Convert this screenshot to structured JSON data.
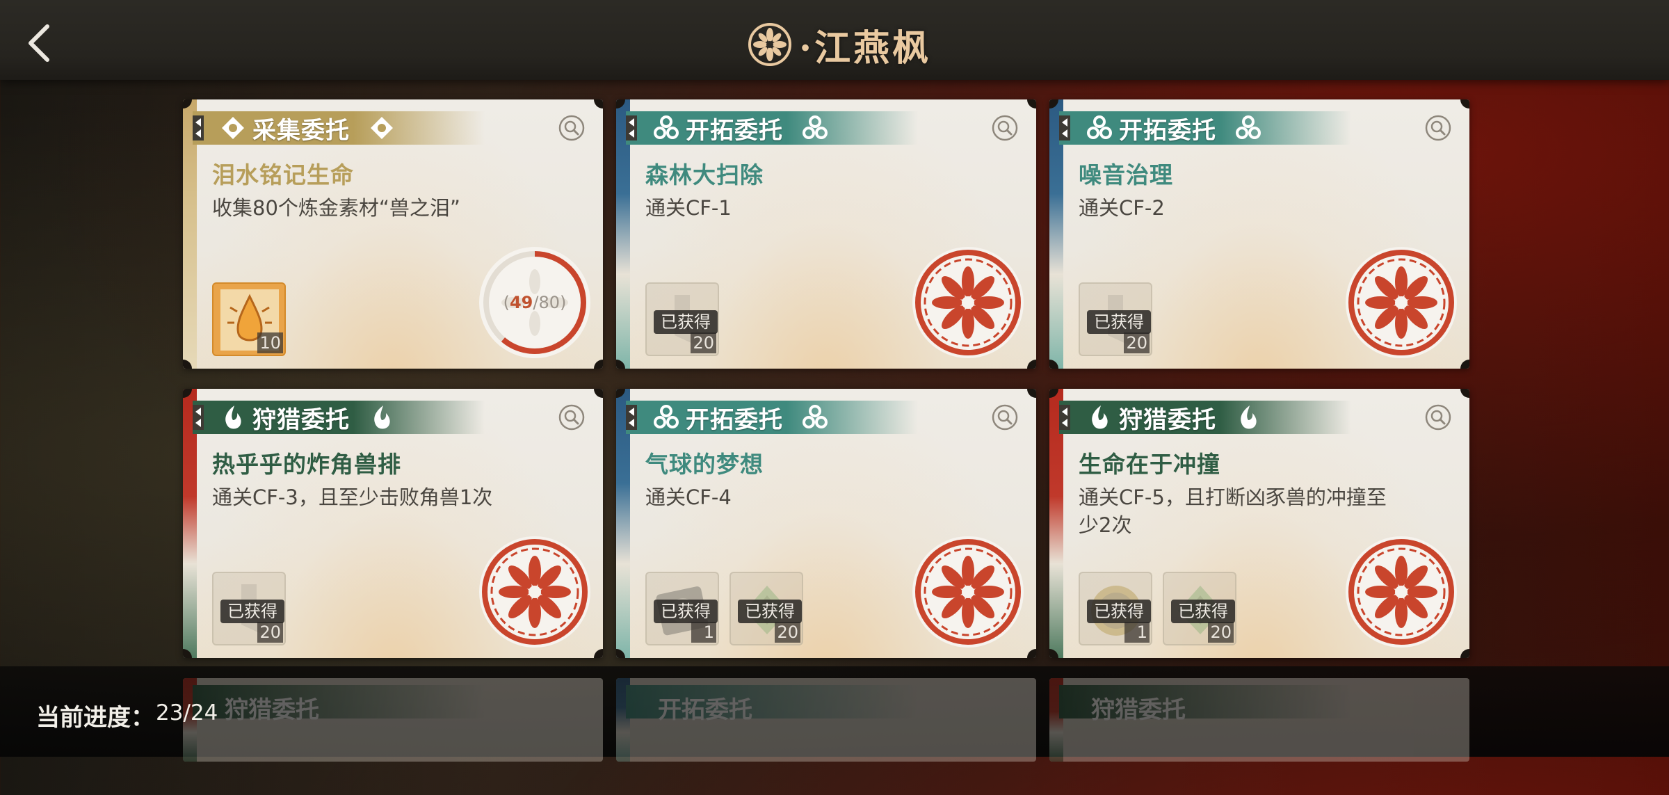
{
  "header": {
    "title": "·江燕枫",
    "back_icon": "chevron-left-icon",
    "emblem_icon": "flower-emblem-icon"
  },
  "colors": {
    "gather": "#b79e5a",
    "explore": "#3f8a7e",
    "hunt": "#2f5d44",
    "hunt_edge": "#b52a1e",
    "explore_edge": "#2c5a82",
    "stamp": "#c9452c"
  },
  "cards": [
    {
      "type": "gather",
      "type_label": "采集委托",
      "title": "泪水铭记生命",
      "desc": "收集80个炼金素材“兽之泪”",
      "rewards": [
        {
          "icon": "crystal-drop-icon",
          "qty": "10",
          "obtained": false
        }
      ],
      "progress": {
        "current": "49",
        "total": "/80",
        "open": "(",
        "close": ")",
        "fraction": 0.6125
      },
      "completed": false
    },
    {
      "type": "explore",
      "type_label": "开拓委托",
      "title": "森林大扫除",
      "desc": "通关CF-1",
      "rewards": [
        {
          "icon": "sock-item-icon",
          "qty": "20",
          "obtained": true,
          "obtained_label": "已获得"
        }
      ],
      "completed": true
    },
    {
      "type": "explore",
      "type_label": "开拓委托",
      "title": "噪音治理",
      "desc": "通关CF-2",
      "rewards": [
        {
          "icon": "sock-item-icon",
          "qty": "20",
          "obtained": true,
          "obtained_label": "已获得"
        }
      ],
      "completed": true
    },
    {
      "type": "hunt",
      "type_label": "狩猎委托",
      "title": "热乎乎的炸角兽排",
      "desc": "通关CF-3，且至少击败角兽1次",
      "rewards": [
        {
          "icon": "sock-item-icon",
          "qty": "20",
          "obtained": true,
          "obtained_label": "已获得"
        }
      ],
      "completed": true
    },
    {
      "type": "explore",
      "type_label": "开拓委托",
      "title": "气球的梦想",
      "desc": "通关CF-4",
      "rewards": [
        {
          "icon": "gear-card-icon",
          "qty": "1",
          "obtained": true,
          "obtained_label": "已获得"
        },
        {
          "icon": "green-gem-icon",
          "qty": "20",
          "obtained": true,
          "obtained_label": "已获得"
        }
      ],
      "completed": true
    },
    {
      "type": "hunt",
      "type_label": "狩猎委托",
      "title": "生命在于冲撞",
      "desc": "通关CF-5，且打断凶豕兽的冲撞至少2次",
      "rewards": [
        {
          "icon": "gold-coin-icon",
          "qty": "1",
          "obtained": true,
          "obtained_label": "已获得"
        },
        {
          "icon": "green-gem-icon",
          "qty": "20",
          "obtained": true,
          "obtained_label": "已获得"
        }
      ],
      "completed": true
    }
  ],
  "peek_cards": [
    {
      "type": "hunt",
      "type_label": "狩猎委托"
    },
    {
      "type": "explore",
      "type_label": "开拓委托"
    },
    {
      "type": "hunt",
      "type_label": "狩猎委托"
    }
  ],
  "footer": {
    "progress_label": "当前进度：",
    "progress_value": "23/24"
  }
}
